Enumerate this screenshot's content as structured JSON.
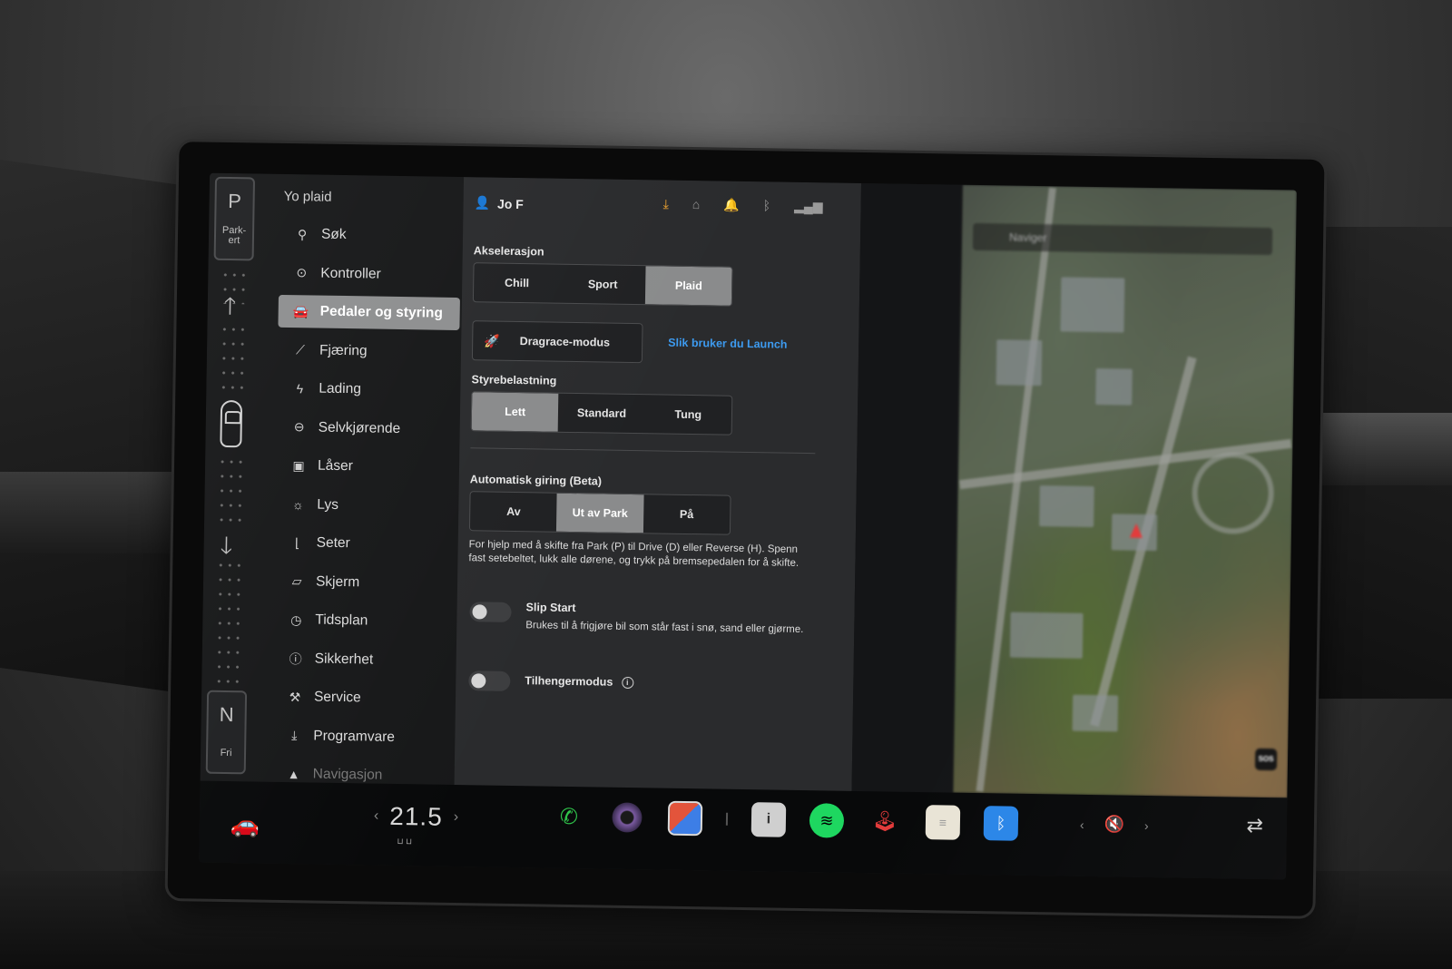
{
  "gear": {
    "top_letter": "P",
    "top_label": "Park-\nert",
    "bottom_letter": "N",
    "bottom_label": "Fri"
  },
  "nav": {
    "title": "Yo plaid",
    "items": [
      {
        "label": "Søk",
        "icon": "search-icon",
        "glyph": "⚲"
      },
      {
        "label": "Kontroller",
        "icon": "toggle-icon",
        "glyph": "⊙"
      },
      {
        "label": "Pedaler og styring",
        "icon": "car-icon",
        "glyph": "▭",
        "active": true
      },
      {
        "label": "Fjæring",
        "icon": "suspension-icon",
        "glyph": "⟋"
      },
      {
        "label": "Lading",
        "icon": "lightning-icon",
        "glyph": "ϟ"
      },
      {
        "label": "Selvkjørende",
        "icon": "steering-icon",
        "glyph": "⊖"
      },
      {
        "label": "Låser",
        "icon": "lock-icon",
        "glyph": "🔒"
      },
      {
        "label": "Lys",
        "icon": "light-icon",
        "glyph": "☼"
      },
      {
        "label": "Seter",
        "icon": "seat-icon",
        "glyph": "⌊"
      },
      {
        "label": "Skjerm",
        "icon": "display-icon",
        "glyph": "▱"
      },
      {
        "label": "Tidsplan",
        "icon": "clock-icon",
        "glyph": "⏰"
      },
      {
        "label": "Sikkerhet",
        "icon": "alert-icon",
        "glyph": "ⓘ"
      },
      {
        "label": "Service",
        "icon": "wrench-icon",
        "glyph": "🔧"
      },
      {
        "label": "Programvare",
        "icon": "download-icon",
        "glyph": "⤓"
      },
      {
        "label": "Navigasjon",
        "icon": "navigation-icon",
        "glyph": "▲"
      }
    ]
  },
  "topbar": {
    "user_name": "Jo F",
    "status_icons": [
      "download-icon",
      "garage-icon",
      "bell-icon",
      "bluetooth-icon",
      "lte-signal-icon"
    ]
  },
  "settings": {
    "acceleration": {
      "label": "Akselerasjon",
      "options": [
        "Chill",
        "Sport",
        "Plaid"
      ],
      "selected": "Plaid"
    },
    "drag_race": {
      "button_label": "Dragrace-modus",
      "link_label": "Slik bruker du Launch"
    },
    "steering": {
      "label": "Styrebelastning",
      "options": [
        "Lett",
        "Standard",
        "Tung"
      ],
      "selected": "Lett"
    },
    "auto_shift": {
      "label": "Automatisk giring (Beta)",
      "options": [
        "Av",
        "Ut av Park",
        "På"
      ],
      "selected": "Ut av Park",
      "description": "For hjelp med å skifte fra Park (P) til Drive (D) eller Reverse (H). Spenn fast setebeltet, lukk alle dørene, og trykk på bremsepedalen for å skifte."
    },
    "slip_start": {
      "label": "Slip Start",
      "description": "Brukes til å frigjøre bil som står fast i snø, sand eller gjørme.",
      "enabled": false
    },
    "trailer_mode": {
      "label": "Tilhengermodus",
      "enabled": false
    }
  },
  "map": {
    "search_placeholder": "Naviger",
    "sos_label": "SOS"
  },
  "dock": {
    "temperature": "21.5",
    "apps": [
      "phone-icon",
      "camera-icon",
      "toybox-icon",
      "manual-icon",
      "spotify-icon",
      "joystick-icon",
      "notes-icon",
      "bluetooth-icon"
    ]
  }
}
